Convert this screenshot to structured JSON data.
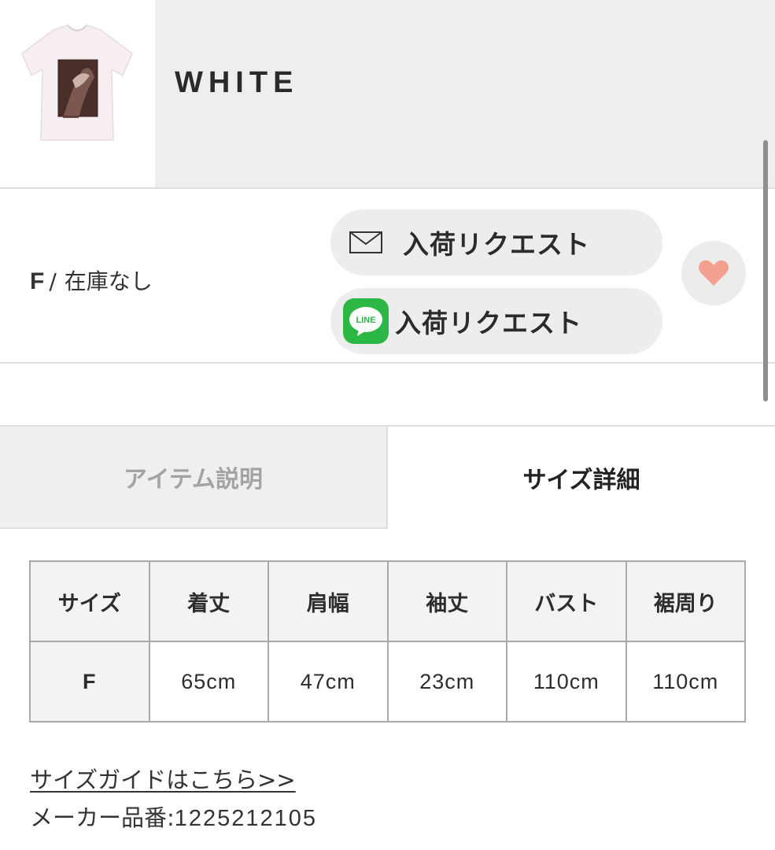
{
  "color": {
    "name": "WHITE"
  },
  "stock": {
    "size": "F",
    "separator": "/",
    "status": "在庫なし",
    "mail_request_label": "入荷リクエスト",
    "line_request_label": "入荷リクエスト",
    "line_icon_text": "LINE"
  },
  "tabs": [
    {
      "label": "アイテム説明",
      "active": false
    },
    {
      "label": "サイズ詳細",
      "active": true
    }
  ],
  "size_table": {
    "headers": [
      "サイズ",
      "着丈",
      "肩幅",
      "袖丈",
      "バスト",
      "裾周り"
    ],
    "rows": [
      [
        "F",
        "65cm",
        "47cm",
        "23cm",
        "110cm",
        "110cm"
      ]
    ]
  },
  "footer": {
    "size_guide_link": "サイズガイドはこちら>>",
    "maker_label": "メーカー品番:",
    "maker_number": "1225212105"
  },
  "colors": {
    "heart": "#f4a090",
    "line_green": "#2db845",
    "panel_gray": "#eeeeee",
    "button_gray": "#ededed"
  }
}
